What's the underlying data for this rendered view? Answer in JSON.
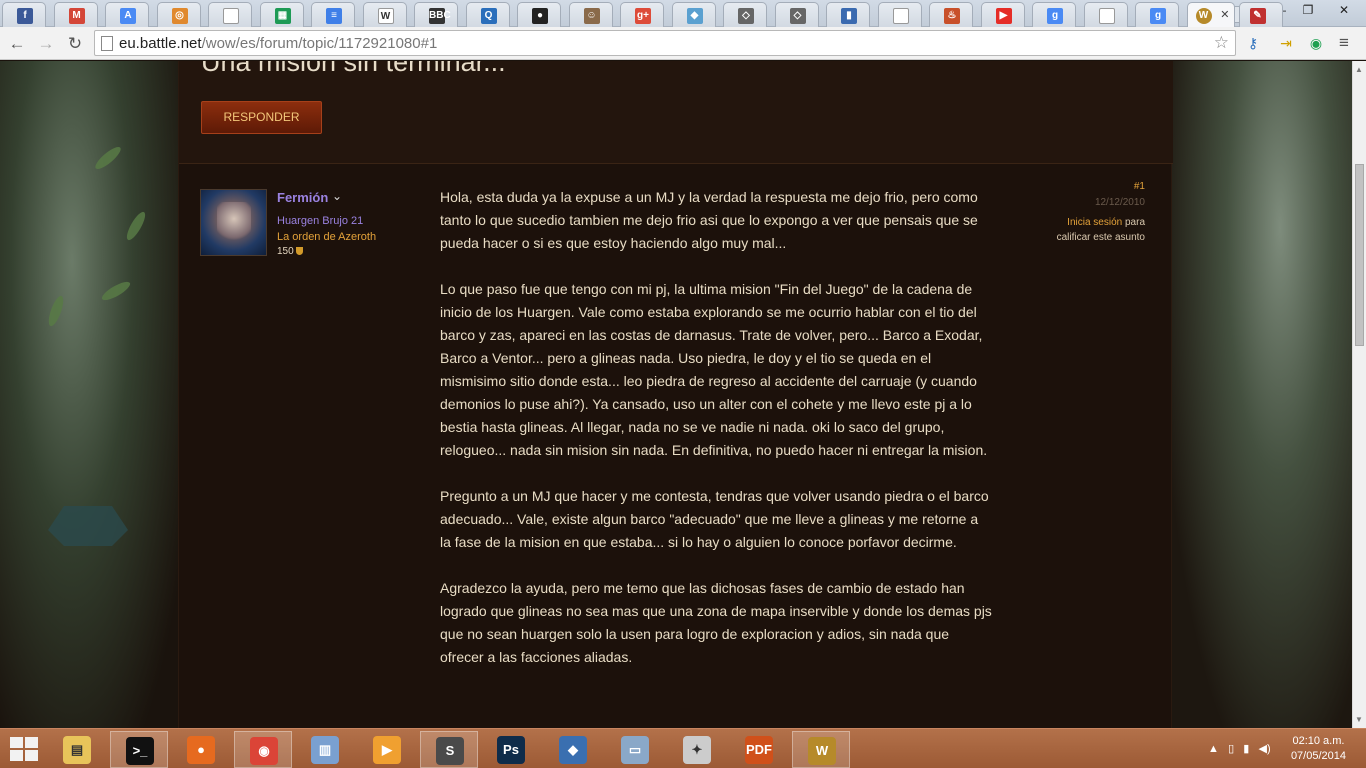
{
  "browser": {
    "tabs": [
      {
        "icon": "facebook-icon",
        "glyph": "f",
        "color": "#3b5998"
      },
      {
        "icon": "gmail-icon",
        "glyph": "M",
        "color": "#d44638"
      },
      {
        "icon": "translate-icon",
        "glyph": "A",
        "color": "#4a8af4"
      },
      {
        "icon": "app-icon",
        "glyph": "◎",
        "color": "#e0892e"
      },
      {
        "icon": "page-icon",
        "glyph": "",
        "color": "#ffffff"
      },
      {
        "icon": "sheets-icon",
        "glyph": "▦",
        "color": "#1d9a55"
      },
      {
        "icon": "docs-icon",
        "glyph": "≡",
        "color": "#3f7fe8"
      },
      {
        "icon": "wikipedia-icon",
        "glyph": "W",
        "color": "#ffffff"
      },
      {
        "icon": "bbc-icon",
        "glyph": "BBC",
        "color": "#333333"
      },
      {
        "icon": "search-site-icon",
        "glyph": "Q",
        "color": "#2a6ebb"
      },
      {
        "icon": "github-icon",
        "glyph": "●",
        "color": "#222222"
      },
      {
        "icon": "avatar-tab-icon",
        "glyph": "☺",
        "color": "#8a6a4a"
      },
      {
        "icon": "google-plus-icon",
        "glyph": "g+",
        "color": "#dd4b39"
      },
      {
        "icon": "drop-icon",
        "glyph": "◆",
        "color": "#5aa0d0"
      },
      {
        "icon": "cube-icon",
        "glyph": "◇",
        "color": "#666666"
      },
      {
        "icon": "cube-icon",
        "glyph": "◇",
        "color": "#666666"
      },
      {
        "icon": "book-icon",
        "glyph": "▮",
        "color": "#3a6ab0"
      },
      {
        "icon": "page-icon",
        "glyph": "",
        "color": "#ffffff"
      },
      {
        "icon": "fire-icon",
        "glyph": "♨",
        "color": "#c8502a"
      },
      {
        "icon": "youtube-icon",
        "glyph": "▶",
        "color": "#e52d27"
      },
      {
        "icon": "google-icon",
        "glyph": "g",
        "color": "#4a8af4"
      },
      {
        "icon": "page-icon",
        "glyph": "",
        "color": "#ffffff"
      },
      {
        "icon": "google-icon",
        "glyph": "g",
        "color": "#4a8af4"
      }
    ],
    "active_tab": {
      "icon": "wow-icon",
      "glyph": "W",
      "color": "#b68a2a",
      "close": "✕"
    },
    "after_tab": {
      "icon": "puzzle-tab-icon",
      "glyph": "✎",
      "color": "#c03030"
    },
    "url_host": "eu.battle.net",
    "url_path": "/wow/es/forum/topic/1172921080#1"
  },
  "topic": {
    "title": "Una mision sin terminar...",
    "reply_label": "RESPONDER"
  },
  "post": {
    "author": "Fermión",
    "char_info": "Huargen Brujo 21",
    "guild": "La orden de Azeroth",
    "points": "150",
    "number": "#1",
    "date": "12/12/2010",
    "login_link": "Inicia sesión",
    "login_rest": "para calificar este asunto",
    "paragraphs": [
      "Hola, esta duda ya la expuse a un MJ y la verdad la respuesta me dejo frio, pero como tanto lo que sucedio tambien me dejo frio asi que lo expongo a ver que pensais que se pueda hacer o si es que estoy haciendo algo muy mal...",
      "Lo que paso fue que tengo con mi pj, la ultima mision \"Fin del Juego\" de la cadena de inicio de los Huargen. Vale como estaba explorando se me ocurrio hablar con el tio del barco y zas, apareci en las costas de darnasus. Trate de volver, pero... Barco a Exodar, Barco a Ventor... pero a glineas nada. Uso piedra, le doy y el tio se queda en el mismisimo sitio donde esta... leo piedra de regreso al accidente del carruaje (y cuando demonios lo puse ahi?). Ya cansado, uso un alter con el cohete y me llevo este pj a lo bestia hasta glineas. Al llegar, nada no se ve nadie ni nada. oki lo saco del grupo, relogueo... nada sin mision sin nada. En definitiva, no puedo hacer ni entregar la mision.",
      "Pregunto a un MJ que hacer y me contesta, tendras que volver usando piedra o el barco adecuado... Vale, existe algun barco \"adecuado\" que me lleve a glineas y me retorne a la fase de la mision en que estaba... si lo hay o alguien lo conoce porfavor decirme.",
      "Agradezco la ayuda, pero me temo que las dichosas fases de cambio de estado han logrado que glineas no sea mas que una zona de mapa inservible y donde los demas pjs que no sean huargen solo la usen para logro de exploracion y adios, sin nada que ofrecer a las facciones aliadas."
    ]
  },
  "taskbar": {
    "apps": [
      {
        "icon": "file-explorer-icon",
        "glyph": "▤",
        "color": "#e8c45a",
        "on": false
      },
      {
        "icon": "terminal-icon",
        "glyph": ">_",
        "color": "#111111",
        "on": true
      },
      {
        "icon": "firefox-icon",
        "glyph": "●",
        "color": "#e66a1f",
        "on": false
      },
      {
        "icon": "chrome-icon",
        "glyph": "◉",
        "color": "#db4437",
        "on": true
      },
      {
        "icon": "archive-icon",
        "glyph": "▥",
        "color": "#7aa0d0",
        "on": false
      },
      {
        "icon": "video-player-icon",
        "glyph": "▶",
        "color": "#f0a030",
        "on": false
      },
      {
        "icon": "sublime-text-icon",
        "glyph": "S",
        "color": "#4a4a4a",
        "on": true
      },
      {
        "icon": "photoshop-icon",
        "glyph": "Ps",
        "color": "#0f2c4a",
        "on": false
      },
      {
        "icon": "virtualbox-icon",
        "glyph": "◆",
        "color": "#3a6fb0",
        "on": false
      },
      {
        "icon": "monitor-icon",
        "glyph": "▭",
        "color": "#8aa8c8",
        "on": false
      },
      {
        "icon": "compass-icon",
        "glyph": "✦",
        "color": "#cccccc",
        "on": false
      },
      {
        "icon": "pdf-icon",
        "glyph": "PDF",
        "color": "#d0501a",
        "on": false
      },
      {
        "icon": "wow-taskbar-icon",
        "glyph": "W",
        "color": "#b68a2a",
        "on": true
      }
    ],
    "time": "02:10 a.m.",
    "date": "07/05/2014"
  }
}
